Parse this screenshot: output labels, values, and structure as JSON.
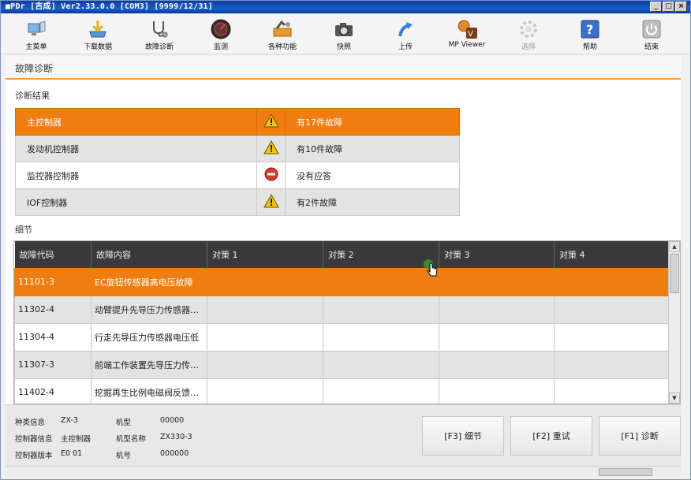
{
  "window": {
    "title": "■PDr [吉成] Ver2.33.0.0 [COM3] [9999/12/31]",
    "buttons": [
      "_",
      "□",
      "×"
    ]
  },
  "toolbar": [
    {
      "label": "主菜单",
      "icon": "monitor-icon"
    },
    {
      "label": "下载数据",
      "icon": "download-icon"
    },
    {
      "label": "故障诊断",
      "icon": "stethoscope-icon"
    },
    {
      "label": "监测",
      "icon": "gauge-icon"
    },
    {
      "label": "各种功能",
      "icon": "tools-icon"
    },
    {
      "label": "快照",
      "icon": "camera-icon"
    },
    {
      "label": "上传",
      "icon": "upload-icon"
    },
    {
      "label": "MP Viewer",
      "icon": "mp-viewer-icon"
    },
    {
      "label": "选择",
      "icon": "gear-icon"
    },
    {
      "label": "帮助",
      "icon": "help-icon"
    },
    {
      "label": "结束",
      "icon": "power-icon"
    }
  ],
  "page": {
    "title": "故障诊断",
    "diag_label": "诊断结果",
    "detail_label": "细节"
  },
  "diagnosis": [
    {
      "controller": "主控制器",
      "status_icon": "warning-icon",
      "status": "有17件故障",
      "selected": true
    },
    {
      "controller": "发动机控制器",
      "status_icon": "warning-icon",
      "status": "有10件故障",
      "selected": false
    },
    {
      "controller": "监控器控制器",
      "status_icon": "no-entry-icon",
      "status": "没有应答",
      "selected": false
    },
    {
      "controller": "IOF控制器",
      "status_icon": "warning-icon",
      "status": "有2件故障",
      "selected": false
    }
  ],
  "detail": {
    "headers": [
      "故障代码",
      "故障内容",
      "对策 1",
      "对策 2",
      "对策 3",
      "对策 4"
    ],
    "rows": [
      {
        "code": "11101-3",
        "content": "EC旋钮传感器高电压故障",
        "selected": true
      },
      {
        "code": "11302-4",
        "content": "动臂提升先导压力传感器低电压故障",
        "selected": false
      },
      {
        "code": "11304-4",
        "content": "行走先导压力传感器电压低",
        "selected": false
      },
      {
        "code": "11307-3",
        "content": "前端工作装置先导压力传感器高电压故障",
        "selected": false
      },
      {
        "code": "11402-4",
        "content": "挖掘再生比例电磁阀反馈电流低",
        "selected": false
      }
    ]
  },
  "footer": {
    "info": [
      {
        "label": "种类信息",
        "value": "ZX-3"
      },
      {
        "label": "控制器信息",
        "value": "主控制器"
      },
      {
        "label": "控制器版本",
        "value": "E0 01"
      },
      {
        "label": "机型",
        "value": "00000"
      },
      {
        "label": "机型名称",
        "value": "ZX330-3"
      },
      {
        "label": "机号",
        "value": "000000"
      }
    ],
    "buttons": [
      "[F3] 细节",
      "[F2] 重试",
      "[F1] 诊断"
    ]
  },
  "colors": {
    "accent": "#f07d12",
    "header_dark": "#3a3a3a",
    "title_bar": "#0b3d9a"
  }
}
